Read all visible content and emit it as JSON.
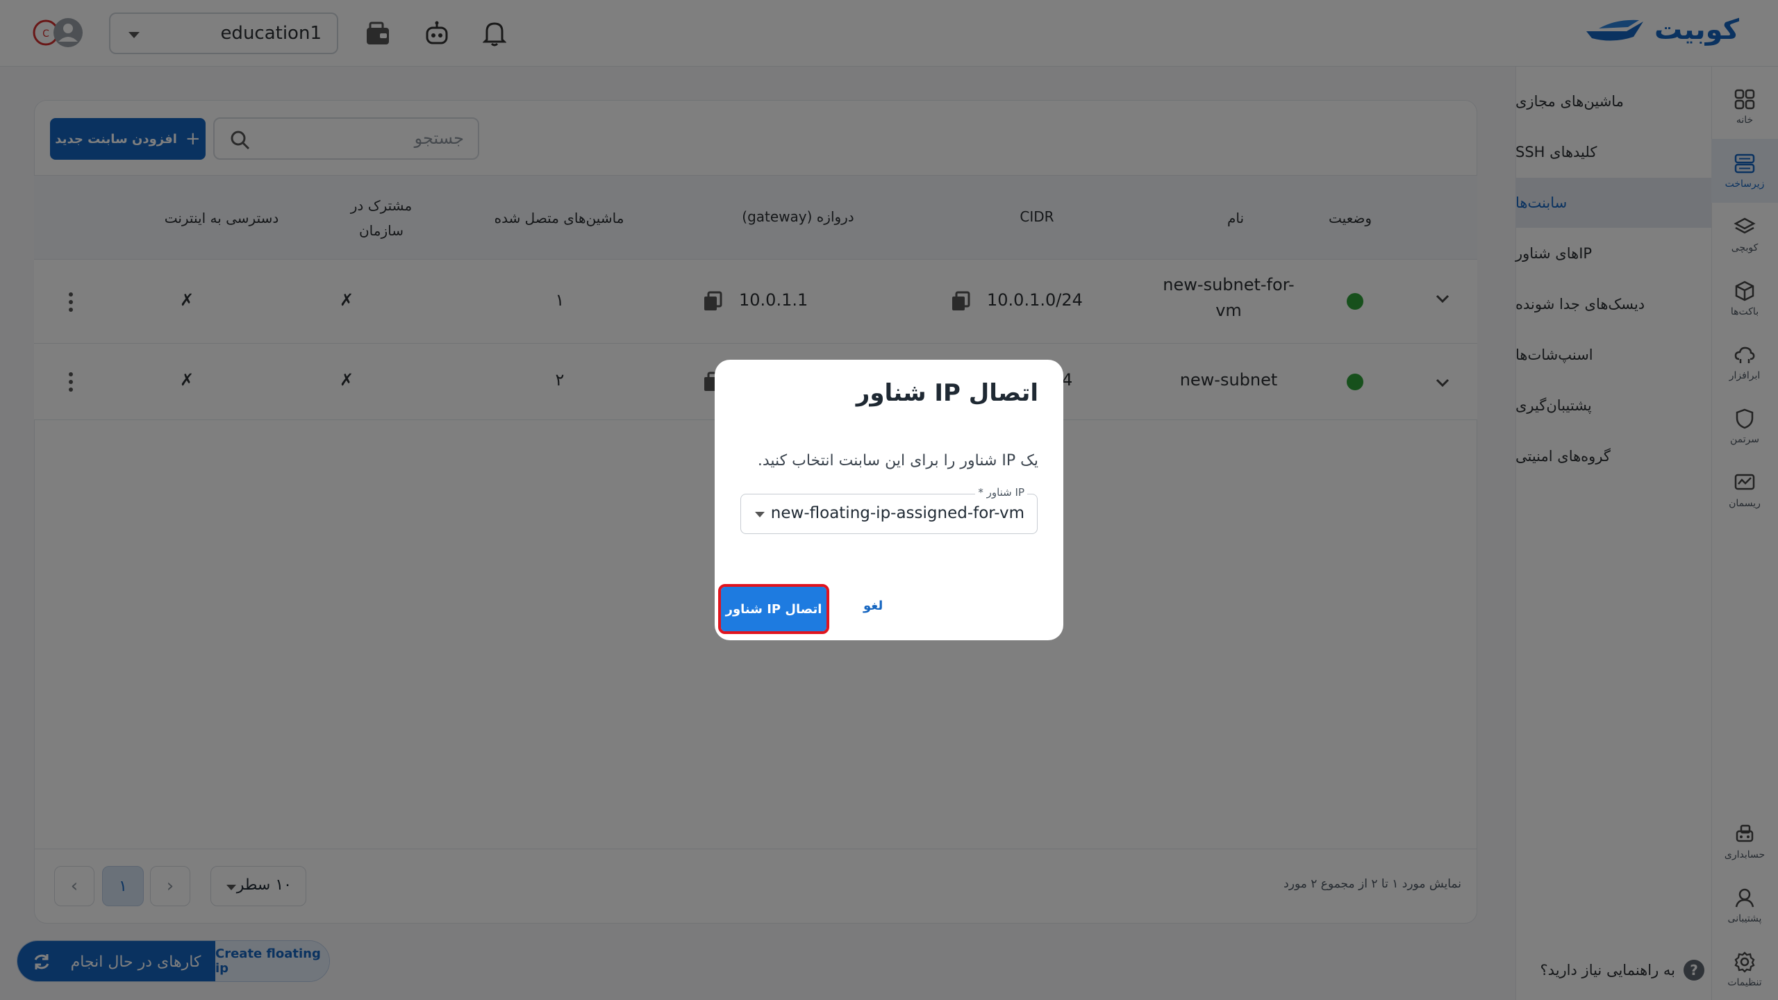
{
  "brand": {
    "name": "کوبیت",
    "color": "#1565c0"
  },
  "header": {
    "environment": "education1",
    "icons": [
      "notification-bell-icon",
      "robot-icon",
      "wallet-icon",
      "user-avatar-icon"
    ]
  },
  "rail": {
    "items": [
      {
        "label": "خانه",
        "icon": "home-grid-icon"
      },
      {
        "label": "زیرساخت",
        "icon": "infrastructure-icon",
        "active": true
      },
      {
        "label": "کوبچی",
        "icon": "layers-icon"
      },
      {
        "label": "باکت‌ها",
        "icon": "bucket-icon"
      },
      {
        "label": "ابرافزار",
        "icon": "cloud-app-icon"
      },
      {
        "label": "سرتمن",
        "icon": "shield-icon"
      },
      {
        "label": "ریسمان",
        "icon": "monitor-icon"
      }
    ],
    "bottom": [
      {
        "label": "حسابداری",
        "icon": "accounting-icon"
      },
      {
        "label": "پشتیبانی",
        "icon": "support-icon"
      },
      {
        "label": "تنظیمات",
        "icon": "settings-gear-icon"
      }
    ]
  },
  "subnav": {
    "items": [
      {
        "label": "ماشین‌های مجازی"
      },
      {
        "label": "کلیدهای SSH"
      },
      {
        "label": "سابنت‌ها",
        "active": true
      },
      {
        "label": "IPهای شناور"
      },
      {
        "label": "دیسک‌های جدا شونده"
      },
      {
        "label": "اسنپ‌شات‌ها"
      },
      {
        "label": "پشتیبان‌گیری"
      },
      {
        "label": "گروه‌های امنیتی"
      }
    ],
    "help": "به راهنمایی نیاز دارید؟"
  },
  "toolbar": {
    "add_label": "افزودن سابنت جدید",
    "search_placeholder": "جستجو"
  },
  "table": {
    "headers": {
      "status": "وضعیت",
      "name": "نام",
      "cidr": "CIDR",
      "gateway": "دروازه (gateway)",
      "machines": "ماشین‌های متصل شده",
      "shared_line1": "مشترک در",
      "shared_line2": "سازمان",
      "internet": "دسترسی به اینترنت"
    },
    "rows": [
      {
        "status": "active",
        "name_line1": "new-subnet-for-",
        "name_line2": "vm",
        "cidr": "10.0.1.0/24",
        "gateway": "10.0.1.1",
        "machines": "۱",
        "shared": "✗",
        "internet": "✗"
      },
      {
        "status": "active",
        "name": "new-subnet",
        "cidr_tail": "4",
        "machines": "۲",
        "shared": "✗",
        "internet": "✗"
      }
    ]
  },
  "pagination": {
    "info": "نمایش مورد ۱ تا ۲ از مجموع ۲ مورد",
    "rows_per_page": "۱۰ سطر",
    "current_page": "۱"
  },
  "tasks": {
    "running_label": "کارهای در حال انجام",
    "last_task": "Create floating ip"
  },
  "modal": {
    "title": "اتصال IP شناور",
    "description": "یک IP شناور را برای این سابنت انتخاب کنید.",
    "field_label": "IP شناور *",
    "field_value": "new-floating-ip-assigned-for-vm",
    "confirm_label": "اتصال IP شناور",
    "cancel_label": "لغو"
  }
}
